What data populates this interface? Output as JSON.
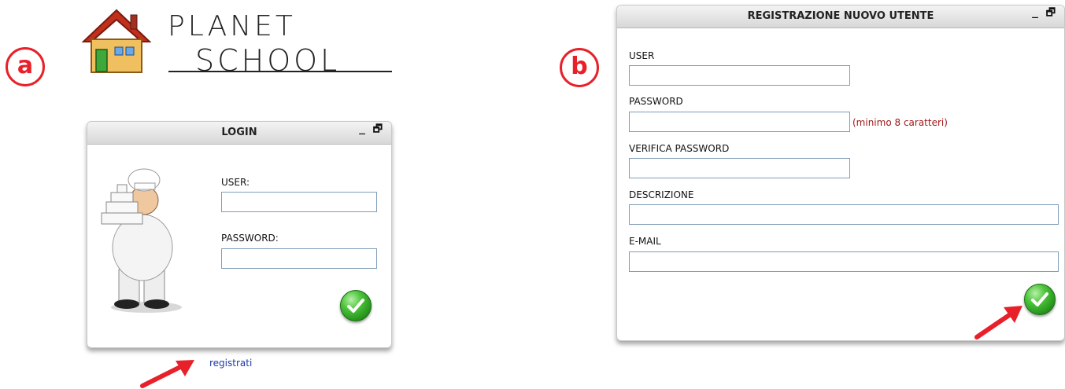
{
  "markers": {
    "a": "a",
    "b": "b"
  },
  "logo": {
    "line1": "PLANET",
    "line2": "SCHOOL"
  },
  "login": {
    "title": "LOGIN",
    "window_controls": "_ 🗗",
    "user_label": "USER:",
    "password_label": "PASSWORD:",
    "user_value": "",
    "password_value": "",
    "register_link": "registrati"
  },
  "register": {
    "title": "REGISTRAZIONE NUOVO UTENTE",
    "window_controls": "_ 🗗",
    "user_label": "USER",
    "password_label": "PASSWORD",
    "password_hint": "(minimo 8 caratteri)",
    "verify_label": "VERIFICA PASSWORD",
    "description_label": "DESCRIZIONE",
    "email_label": "E-MAIL"
  },
  "colors": {
    "accent_red": "#e8202a",
    "ok_green": "#2fa82a",
    "link_blue": "#1a3aa8",
    "hint_red": "#a01818"
  }
}
